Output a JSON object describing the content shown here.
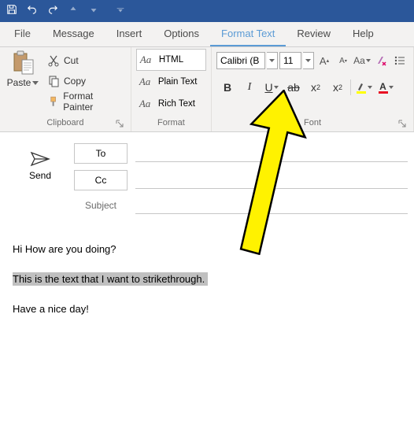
{
  "tabs": {
    "file": "File",
    "message": "Message",
    "insert": "Insert",
    "options": "Options",
    "format_text": "Format Text",
    "review": "Review",
    "help": "Help"
  },
  "clipboard": {
    "paste": "Paste",
    "cut": "Cut",
    "copy": "Copy",
    "format_painter": "Format Painter",
    "group_label": "Clipboard"
  },
  "format": {
    "html": "HTML",
    "plain_text": "Plain Text",
    "rich_text": "Rich Text",
    "group_label": "Format"
  },
  "font": {
    "name": "Calibri (B",
    "size": "11",
    "group_label": "Font"
  },
  "compose": {
    "send": "Send",
    "to": "To",
    "cc": "Cc",
    "subject": "Subject"
  },
  "body": {
    "line1": "Hi How are you doing?",
    "line2": "This is the text that I want to strikethrough.   ",
    "line3": "Have a nice day!"
  }
}
